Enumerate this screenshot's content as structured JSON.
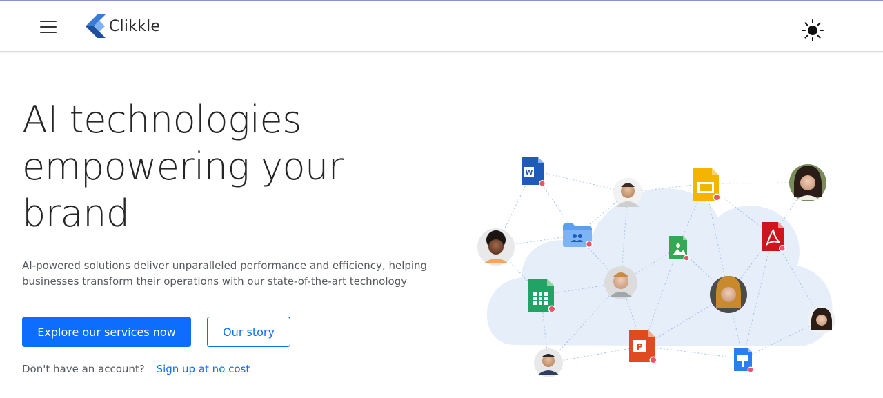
{
  "header": {
    "brand_name": "Clikkle",
    "menu_icon": "hamburger-icon",
    "theme_icon": "sun-icon"
  },
  "hero": {
    "title_lines": [
      "AI technologies",
      "empowering your",
      "brand"
    ],
    "subtitle_lines": [
      "AI-powered solutions deliver unparalleled performance and efficiency, helping",
      "businesses transform their operations with our state-of-the-art technology"
    ],
    "primary_button": "Explore our services now",
    "secondary_button": "Our story",
    "signup_prompt": "Don't have an account?",
    "signup_link": "Sign up at no cost"
  },
  "illustration": {
    "icons": [
      "word-doc-icon",
      "google-slides-icon",
      "shared-folder-icon",
      "image-file-icon",
      "pdf-file-icon",
      "google-sheets-icon",
      "powerpoint-file-icon",
      "keynote-file-icon"
    ],
    "people": [
      "person-avatar",
      "person-avatar",
      "person-avatar",
      "person-avatar",
      "person-avatar",
      "person-avatar",
      "person-avatar"
    ]
  },
  "colors": {
    "primary": "#0d6efd",
    "text": "#252525",
    "muted": "#555a60",
    "cloud": "#e6eef9"
  }
}
